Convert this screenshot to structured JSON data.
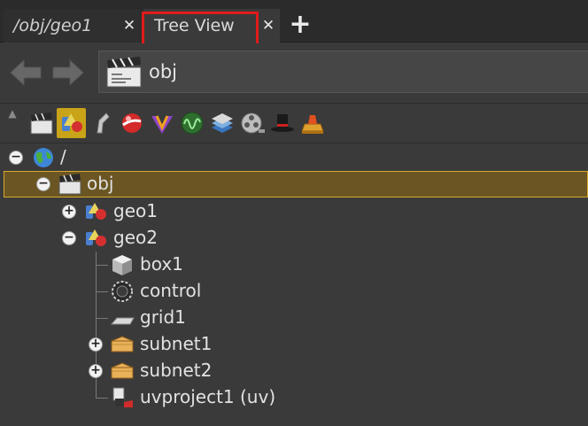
{
  "tabs": [
    {
      "label": "/obj/geo1",
      "close": "✕"
    },
    {
      "label": "Tree View",
      "close": "✕"
    }
  ],
  "add_tab": "+",
  "nav": {
    "back_icon": "arrow-left-icon",
    "forward_icon": "arrow-right-icon",
    "path": "obj",
    "path_icon": "clapperboard-icon"
  },
  "toolbar": {
    "buttons": [
      {
        "icon": "clapperboard-icon"
      },
      {
        "icon": "geometry-icon",
        "active": true
      },
      {
        "icon": "dynamics-icon"
      },
      {
        "icon": "shader-sphere-icon"
      },
      {
        "icon": "vop-icon"
      },
      {
        "icon": "channel-wave-icon"
      },
      {
        "icon": "composite-stack-icon"
      },
      {
        "icon": "film-reel-icon"
      },
      {
        "icon": "top-hat-icon"
      },
      {
        "icon": "task-icon"
      }
    ]
  },
  "tree": {
    "root": {
      "label": "/",
      "icon": "globe-icon"
    },
    "obj": {
      "label": "obj",
      "icon": "clapperboard-icon"
    },
    "geo1": {
      "label": "geo1",
      "icon": "geometry-icon"
    },
    "geo2": {
      "label": "geo2",
      "icon": "geometry-icon"
    },
    "box1": {
      "label": "box1",
      "icon": "box-icon"
    },
    "control": {
      "label": "control",
      "icon": "gear-icon"
    },
    "grid1": {
      "label": "grid1",
      "icon": "grid-plane-icon"
    },
    "subnet1": {
      "label": "subnet1",
      "icon": "subnet-box-icon"
    },
    "subnet2": {
      "label": "subnet2",
      "icon": "subnet-box-icon"
    },
    "uvproject1": {
      "label": "uvproject1 (uv)",
      "icon": "uv-project-icon"
    }
  },
  "colors": {
    "selection_fill": "#6b5623",
    "selection_border": "#d7a92d",
    "active_tool": "#c9a318",
    "highlight_box": "#e11b1b"
  }
}
